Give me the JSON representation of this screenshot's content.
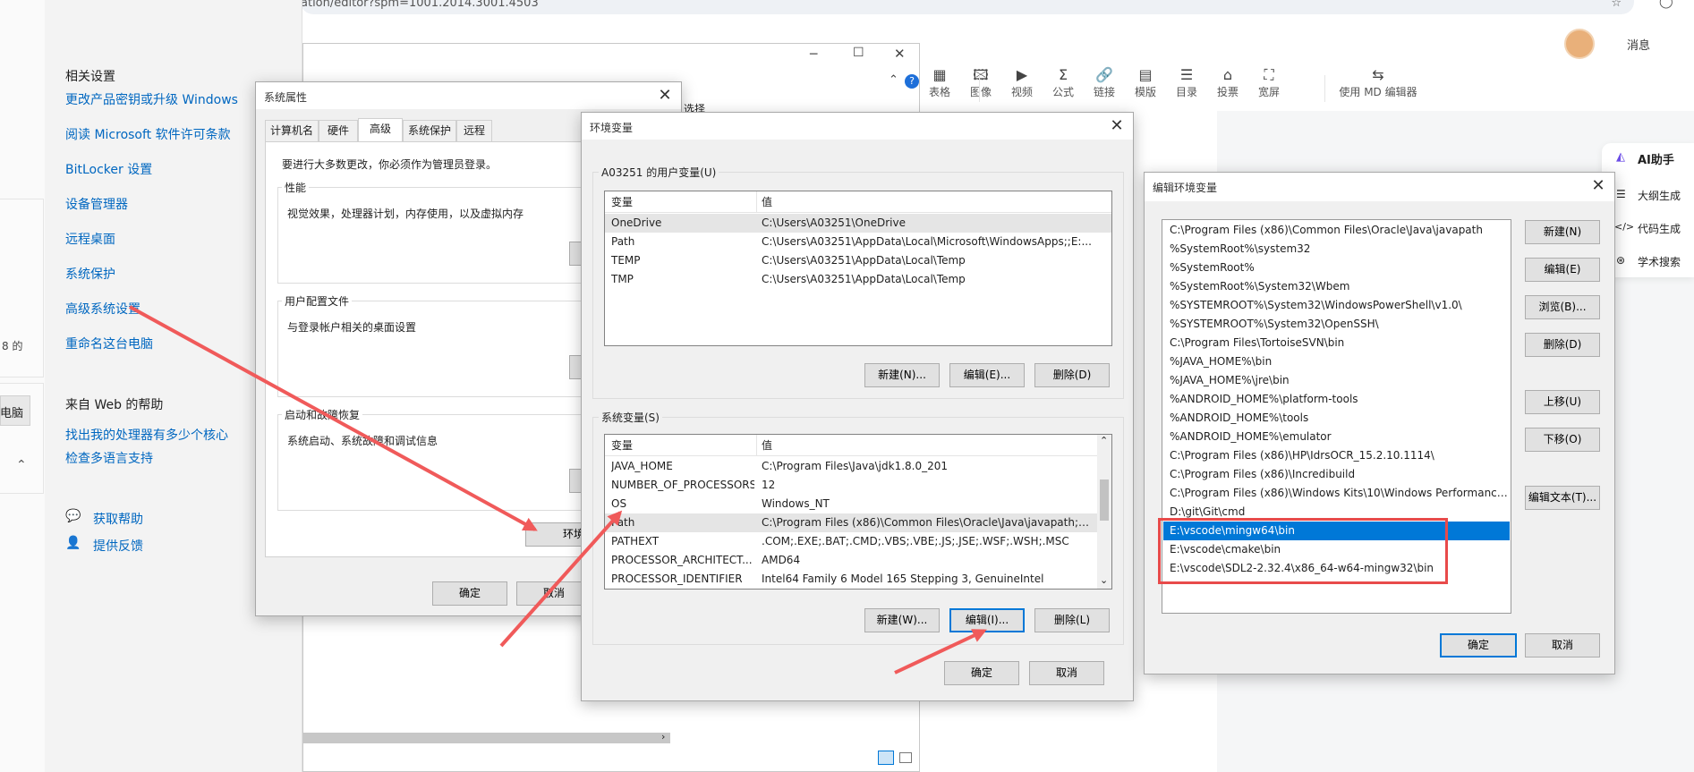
{
  "browser": {
    "url": "ation/editor?spm=1001.2014.3001.4503"
  },
  "settings_left": {
    "related_header": "相关设置",
    "links": [
      "更改产品密钥或升级 Windows",
      "阅读 Microsoft 软件许可条款",
      "BitLocker 设置",
      "设备管理器",
      "远程桌面",
      "系统保护",
      "高级系统设置",
      "重命名这台电脑"
    ],
    "web_help_header": "来自 Web 的帮助",
    "web_links": [
      "找出我的处理器有多少个核心",
      "检查多语言支持"
    ],
    "help": [
      "获取帮助",
      "提供反馈"
    ],
    "cut_text_ram": "8 的",
    "cut_text_pc": "电脑"
  },
  "editor": {
    "user_msg": "消息",
    "toolbar": [
      {
        "label": "表格",
        "icon": "table-icon"
      },
      {
        "label": "图像",
        "icon": "image-icon"
      },
      {
        "label": "视频",
        "icon": "video-icon"
      },
      {
        "label": "公式",
        "icon": "formula-icon"
      },
      {
        "label": "链接",
        "icon": "link-icon"
      },
      {
        "label": "模版",
        "icon": "template-icon"
      },
      {
        "label": "目录",
        "icon": "toc-icon"
      },
      {
        "label": "投票",
        "icon": "vote-icon"
      },
      {
        "label": "宽屏",
        "icon": "widescreen-icon"
      },
      {
        "label": "使用 MD 编辑器",
        "icon": "md-icon"
      }
    ],
    "ai": {
      "title": "AI助手",
      "items": [
        "大纲生成",
        "代码生成",
        "学术搜索"
      ]
    },
    "bg_select": "选择"
  },
  "sys_props": {
    "title": "系统属性",
    "tabs": [
      "计算机名",
      "硬件",
      "高级",
      "系统保护",
      "远程"
    ],
    "admin_note": "要进行大多数更改，你必须作为管理员登录。",
    "perf_label": "性能",
    "perf_desc": "视觉效果，处理器计划，内存使用，以及虚拟内存",
    "profile_label": "用户配置文件",
    "profile_desc": "与登录帐户相关的桌面设置",
    "startup_label": "启动和故障恢复",
    "startup_desc": "系统启动、系统故障和调试信息",
    "env_btn": "环境变",
    "ok": "确定",
    "cancel": "取消"
  },
  "env_vars": {
    "title": "环境变量",
    "user_group": "A03251 的用户变量(U)",
    "col_var": "变量",
    "col_val": "值",
    "user_vars": [
      {
        "name": "OneDrive",
        "value": "C:\\Users\\A03251\\OneDrive"
      },
      {
        "name": "Path",
        "value": "C:\\Users\\A03251\\AppData\\Local\\Microsoft\\WindowsApps;;E:..."
      },
      {
        "name": "TEMP",
        "value": "C:\\Users\\A03251\\AppData\\Local\\Temp"
      },
      {
        "name": "TMP",
        "value": "C:\\Users\\A03251\\AppData\\Local\\Temp"
      }
    ],
    "user_buttons": [
      "新建(N)...",
      "编辑(E)...",
      "删除(D)"
    ],
    "sys_group": "系统变量(S)",
    "sys_vars": [
      {
        "name": "JAVA_HOME",
        "value": "C:\\Program Files\\Java\\jdk1.8.0_201"
      },
      {
        "name": "NUMBER_OF_PROCESSORS",
        "value": "12"
      },
      {
        "name": "OS",
        "value": "Windows_NT"
      },
      {
        "name": "Path",
        "value": "C:\\Program Files (x86)\\Common Files\\Oracle\\Java\\javapath;C:..."
      },
      {
        "name": "PATHEXT",
        "value": ".COM;.EXE;.BAT;.CMD;.VBS;.VBE;.JS;.JSE;.WSF;.WSH;.MSC"
      },
      {
        "name": "PROCESSOR_ARCHITECT...",
        "value": "AMD64"
      },
      {
        "name": "PROCESSOR_IDENTIFIER",
        "value": "Intel64 Family 6 Model 165 Stepping 3, GenuineIntel"
      }
    ],
    "sys_buttons": [
      "新建(W)...",
      "编辑(I)...",
      "删除(L)"
    ],
    "ok": "确定",
    "cancel": "取消"
  },
  "edit_env": {
    "title": "编辑环境变量",
    "entries": [
      "C:\\Program Files (x86)\\Common Files\\Oracle\\Java\\javapath",
      "%SystemRoot%\\system32",
      "%SystemRoot%",
      "%SystemRoot%\\System32\\Wbem",
      "%SYSTEMROOT%\\System32\\WindowsPowerShell\\v1.0\\",
      "%SYSTEMROOT%\\System32\\OpenSSH\\",
      "C:\\Program Files\\TortoiseSVN\\bin",
      "%JAVA_HOME%\\bin",
      "%JAVA_HOME%\\jre\\bin",
      "%ANDROID_HOME%\\platform-tools",
      "%ANDROID_HOME%\\tools",
      "%ANDROID_HOME%\\emulator",
      "C:\\Program Files (x86)\\HP\\IdrsOCR_15.2.10.1114\\",
      "C:\\Program Files (x86)\\Incredibuild",
      "C:\\Program Files (x86)\\Windows Kits\\10\\Windows Performance ...",
      "D:\\git\\Git\\cmd",
      "E:\\vscode\\mingw64\\bin",
      "E:\\vscode\\cmake\\bin",
      "E:\\vscode\\SDL2-2.32.4\\x86_64-w64-mingw32\\bin"
    ],
    "buttons": [
      "新建(N)",
      "编辑(E)",
      "浏览(B)...",
      "删除(D)",
      "上移(U)",
      "下移(O)",
      "编辑文本(T)..."
    ],
    "ok": "确定",
    "cancel": "取消"
  },
  "colors": {
    "accent": "#0078d7",
    "arrow": "#f05a5a",
    "link": "#0067c0"
  }
}
